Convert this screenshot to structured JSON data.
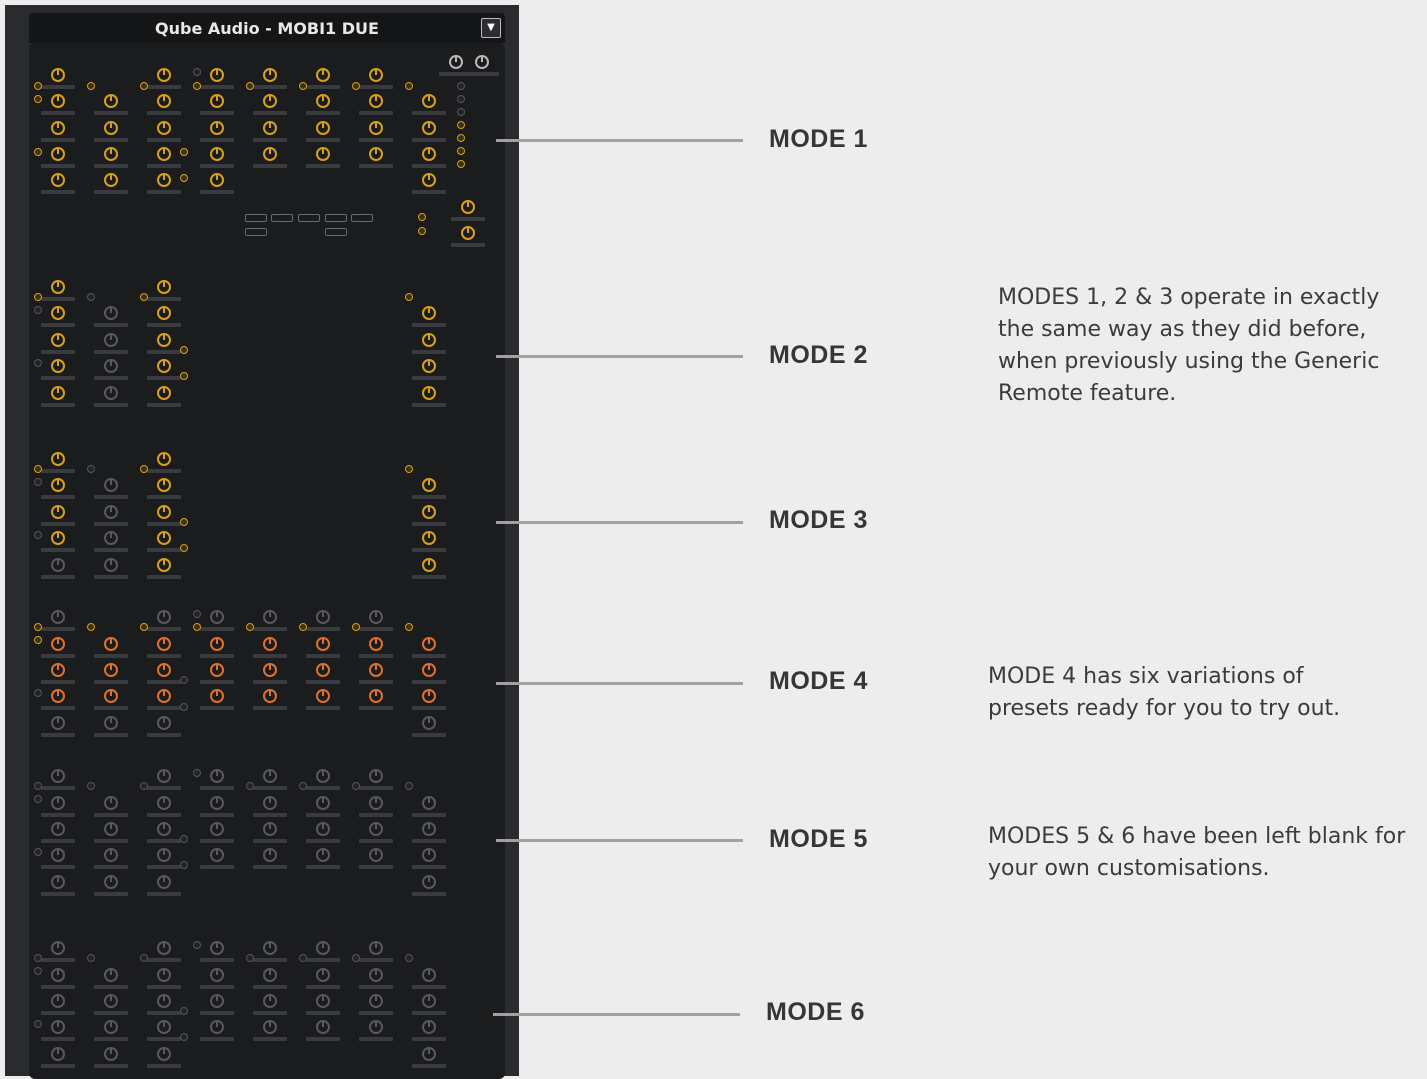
{
  "window": {
    "title": "Qube Audio - MOBI1 DUE",
    "menu_icon": "triangle-down-icon"
  },
  "modes": [
    {
      "label": "MODE 1"
    },
    {
      "label": "MODE 2"
    },
    {
      "label": "MODE 3"
    },
    {
      "label": "MODE 4"
    },
    {
      "label": "MODE 5"
    },
    {
      "label": "MODE 6"
    }
  ],
  "notes": {
    "modes_1_2_3": "MODES 1, 2 & 3 operate in exactly the same way as they did before, when previously using the Generic Remote feature.",
    "mode_4": "MODE 4 has six variations of presets ready for you to try out.",
    "modes_5_6": "MODES 5 & 6 have been left blank for your own customisations."
  },
  "colors": {
    "accent_gold": "#d6a01d",
    "accent_orange": "#e0702a",
    "panel_bg": "#1b1c1e",
    "connector": "#a1a1a1"
  }
}
